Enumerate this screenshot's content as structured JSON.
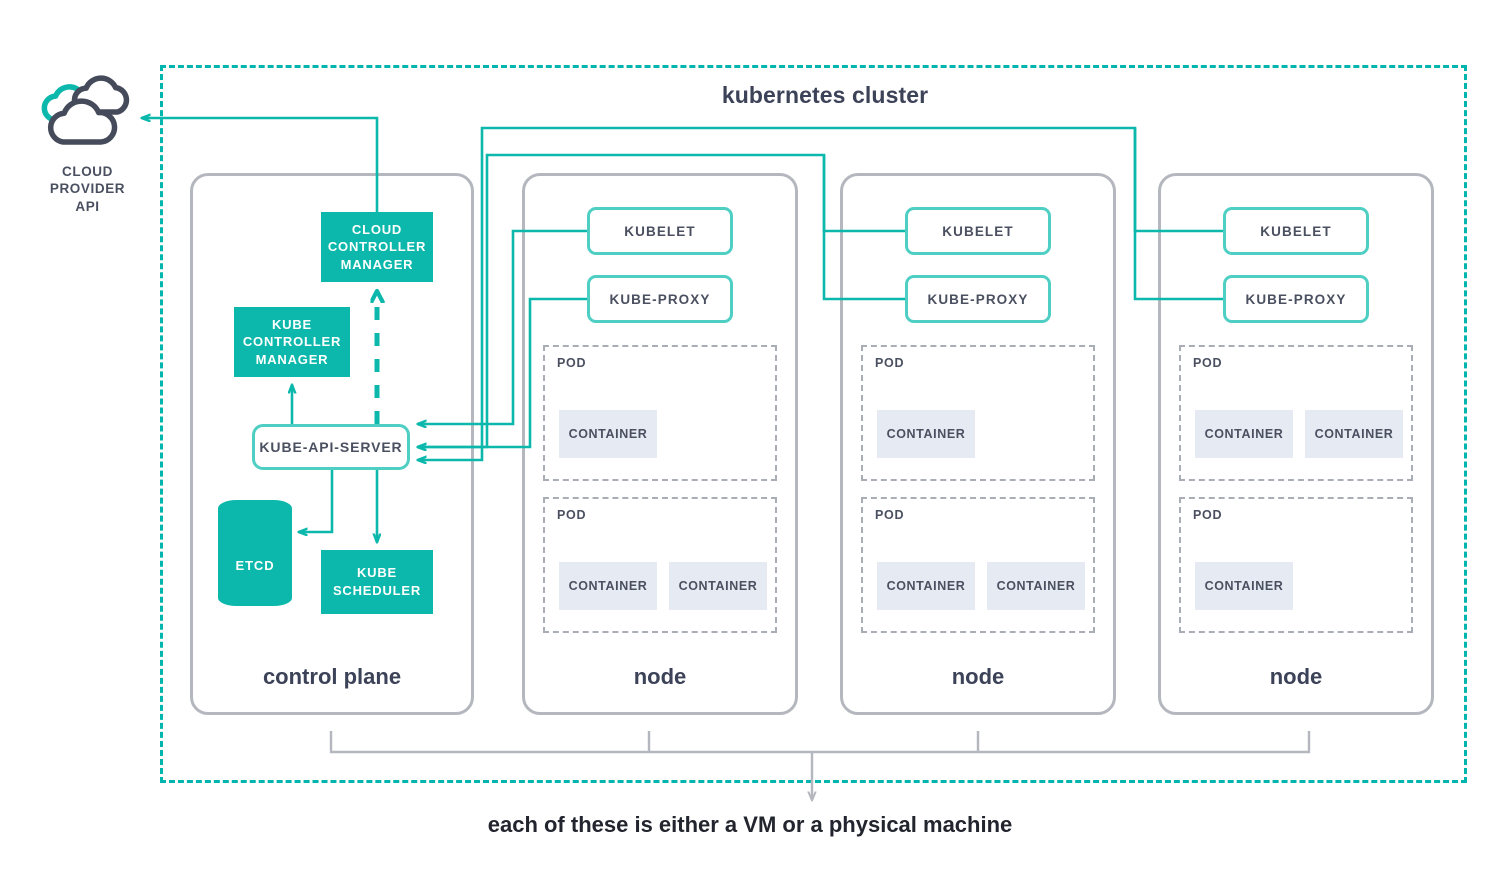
{
  "diagram": {
    "cluster_title": "kubernetes cluster",
    "bottom_caption": "each of these is either a VM or a physical machine"
  },
  "cloud_provider": {
    "label_line1": "CLOUD",
    "label_line2": "PROVIDER",
    "label_line3": "API",
    "icon": "cloud-icon"
  },
  "control_plane": {
    "label": "control plane",
    "components": {
      "cloud_controller_manager": "CLOUD\nCONTROLLER\nMANAGER",
      "cloud_controller_manager_l1": "CLOUD",
      "cloud_controller_manager_l2": "CONTROLLER",
      "cloud_controller_manager_l3": "MANAGER",
      "kube_controller_manager_l1": "KUBE",
      "kube_controller_manager_l2": "CONTROLLER",
      "kube_controller_manager_l3": "MANAGER",
      "kube_api_server": "KUBE-API-SERVER",
      "etcd": "ETCD",
      "kube_scheduler_l1": "KUBE",
      "kube_scheduler_l2": "SCHEDULER"
    }
  },
  "nodes": [
    {
      "label": "node",
      "kubelet": "KUBELET",
      "kube_proxy": "KUBE-PROXY",
      "pods": [
        {
          "label": "POD",
          "containers": [
            "CONTAINER"
          ]
        },
        {
          "label": "POD",
          "containers": [
            "CONTAINER",
            "CONTAINER"
          ]
        }
      ]
    },
    {
      "label": "node",
      "kubelet": "KUBELET",
      "kube_proxy": "KUBE-PROXY",
      "pods": [
        {
          "label": "POD",
          "containers": [
            "CONTAINER"
          ]
        },
        {
          "label": "POD",
          "containers": [
            "CONTAINER",
            "CONTAINER"
          ]
        }
      ]
    },
    {
      "label": "node",
      "kubelet": "KUBELET",
      "kube_proxy": "KUBE-PROXY",
      "pods": [
        {
          "label": "POD",
          "containers": [
            "CONTAINER",
            "CONTAINER"
          ]
        },
        {
          "label": "POD",
          "containers": [
            "CONTAINER"
          ]
        }
      ]
    }
  ],
  "colors": {
    "teal_fill": "#0bb8ab",
    "teal_outline": "#4fcfc4",
    "teal_line": "#00b5ad",
    "panel_gray": "#b4b7bd",
    "pod_dash_gray": "#a9adb6",
    "container_fill": "#e6eaf3",
    "text_dark": "#3c4257",
    "text_body": "#4a5060"
  }
}
